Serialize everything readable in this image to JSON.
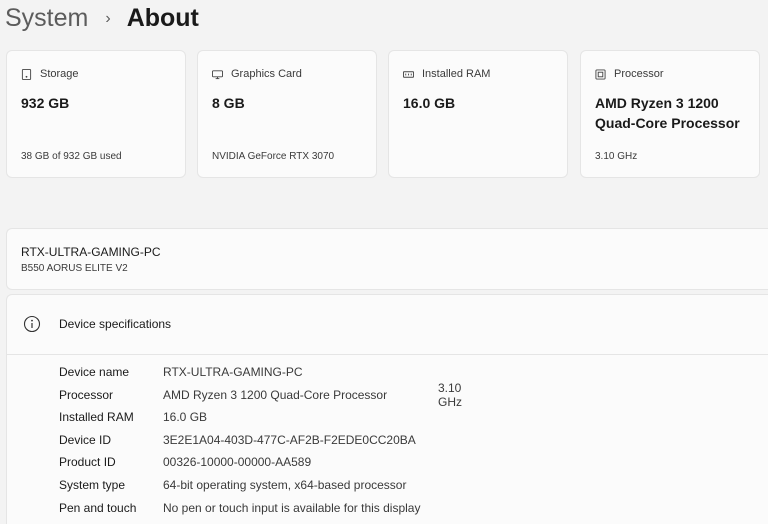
{
  "breadcrumb": {
    "parent": "System",
    "separator": "›",
    "current": "About"
  },
  "cards": [
    {
      "icon": "storage-icon",
      "label": "Storage",
      "value": "932 GB",
      "sub": "38 GB of 932 GB used"
    },
    {
      "icon": "graphics-card-icon",
      "label": "Graphics Card",
      "value": "8 GB",
      "sub": "NVIDIA GeForce RTX 3070"
    },
    {
      "icon": "ram-icon",
      "label": "Installed RAM",
      "value": "16.0 GB",
      "sub": ""
    },
    {
      "icon": "processor-icon",
      "label": "Processor",
      "value": "AMD Ryzen 3 1200 Quad-Core Processor",
      "sub": "3.10 GHz"
    }
  ],
  "device": {
    "name": "RTX-ULTRA-GAMING-PC",
    "model": "B550 AORUS ELITE V2"
  },
  "specs": {
    "title": "Device specifications",
    "rows": [
      {
        "label": "Device name",
        "value": "RTX-ULTRA-GAMING-PC",
        "extra": ""
      },
      {
        "label": "Processor",
        "value": "AMD Ryzen 3 1200 Quad-Core Processor",
        "extra": "3.10 GHz"
      },
      {
        "label": "Installed RAM",
        "value": "16.0 GB",
        "extra": ""
      },
      {
        "label": "Device ID",
        "value": "3E2E1A04-403D-477C-AF2B-F2EDE0CC20BA",
        "extra": ""
      },
      {
        "label": "Product ID",
        "value": "00326-10000-00000-AA589",
        "extra": ""
      },
      {
        "label": "System type",
        "value": "64-bit operating system, x64-based processor",
        "extra": ""
      },
      {
        "label": "Pen and touch",
        "value": "No pen or touch input is available for this display",
        "extra": ""
      }
    ]
  }
}
